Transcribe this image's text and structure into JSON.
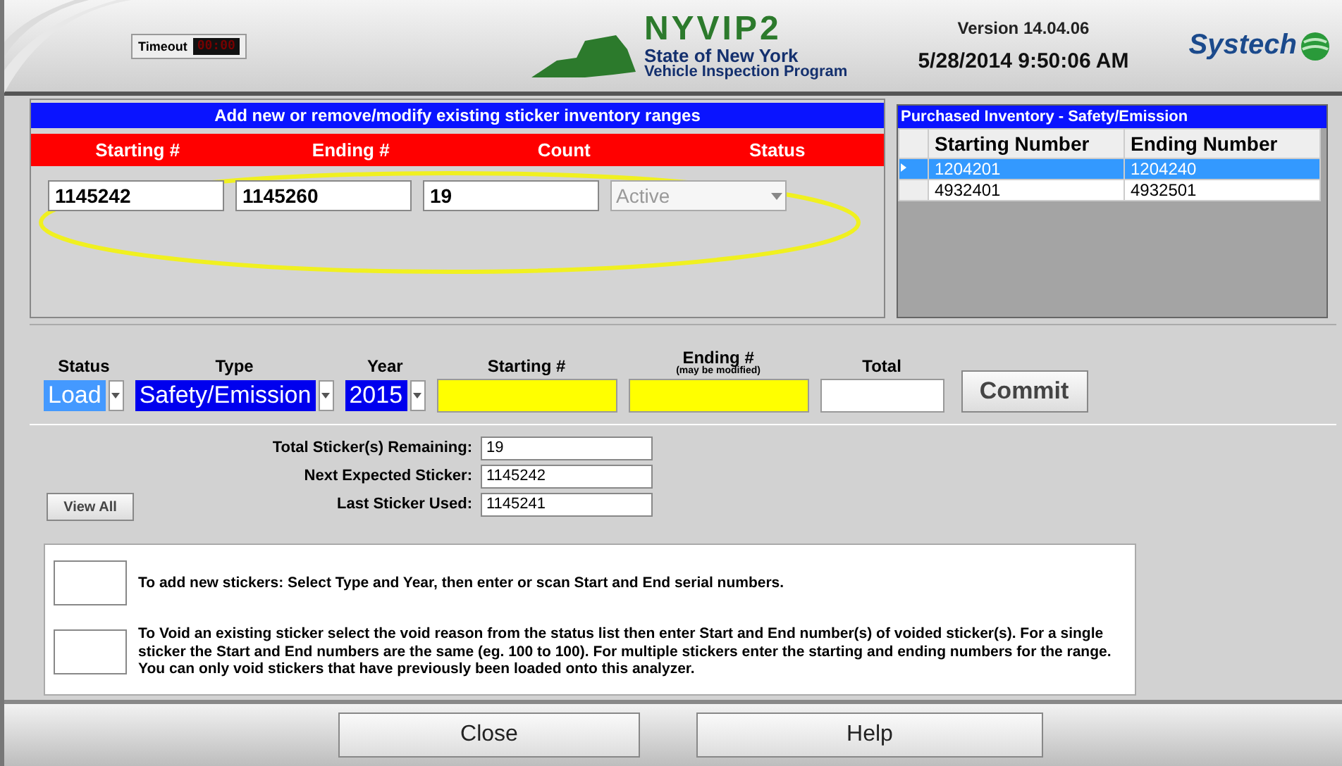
{
  "header": {
    "timeout_label": "Timeout",
    "timeout_value": "00:00",
    "logo_title": "NYVIP2",
    "logo_line1": "State of New York",
    "logo_line2": "Vehicle Inspection Program",
    "version": "Version 14.04.06",
    "datetime": "5/28/2014 9:50:06 AM",
    "brand": "Systech"
  },
  "range_editor": {
    "title": "Add new or remove/modify existing sticker inventory ranges",
    "columns": [
      "Starting #",
      "Ending #",
      "Count",
      "Status"
    ],
    "starting": "1145242",
    "ending": "1145260",
    "count": "19",
    "status": {
      "value": "Active",
      "disabled": true
    }
  },
  "purchased_inventory": {
    "title": "Purchased Inventory - Safety/Emission",
    "columns": [
      "Starting Number",
      "Ending Number"
    ],
    "rows": [
      {
        "cells": [
          "1204201",
          "1204240"
        ],
        "selected": true
      },
      {
        "cells": [
          "4932401",
          "4932501"
        ],
        "selected": false
      }
    ]
  },
  "entry": {
    "fields": [
      {
        "kind": "dropdown",
        "label": "Status",
        "value": "Load",
        "color": "#4499ff"
      },
      {
        "kind": "dropdown",
        "label": "Type",
        "value": "Safety/Emission",
        "color": "#0000ee"
      },
      {
        "kind": "dropdown",
        "label": "Year",
        "value": "2015",
        "color": "#0000ee"
      },
      {
        "kind": "input",
        "label": "Starting #",
        "color": "#ffff00"
      },
      {
        "kind": "input",
        "label": "Ending #",
        "sublabel": "(may be modified)",
        "color": "#ffff00"
      },
      {
        "kind": "input",
        "label": "Total",
        "color": "#ffffff"
      }
    ],
    "commit": "Commit"
  },
  "summary": [
    {
      "label": "Total Sticker(s) Remaining:",
      "value": "19"
    },
    {
      "label": "Next Expected Sticker:",
      "value": "1145242"
    },
    {
      "label": "Last Sticker Used:",
      "value": "1145241"
    }
  ],
  "view_all": "View All",
  "instructions": [
    "To add new stickers: Select Type and Year, then enter or scan Start and End serial numbers.",
    "To Void an existing sticker select the void reason from the status list then enter Start and End number(s) of voided sticker(s).   For a single sticker the Start and End numbers are the same  (eg. 100 to 100). For multiple stickers enter the starting and ending numbers for the range. You can only void stickers that have previously been loaded onto this analyzer."
  ],
  "buttons": [
    "Close",
    "Help"
  ]
}
